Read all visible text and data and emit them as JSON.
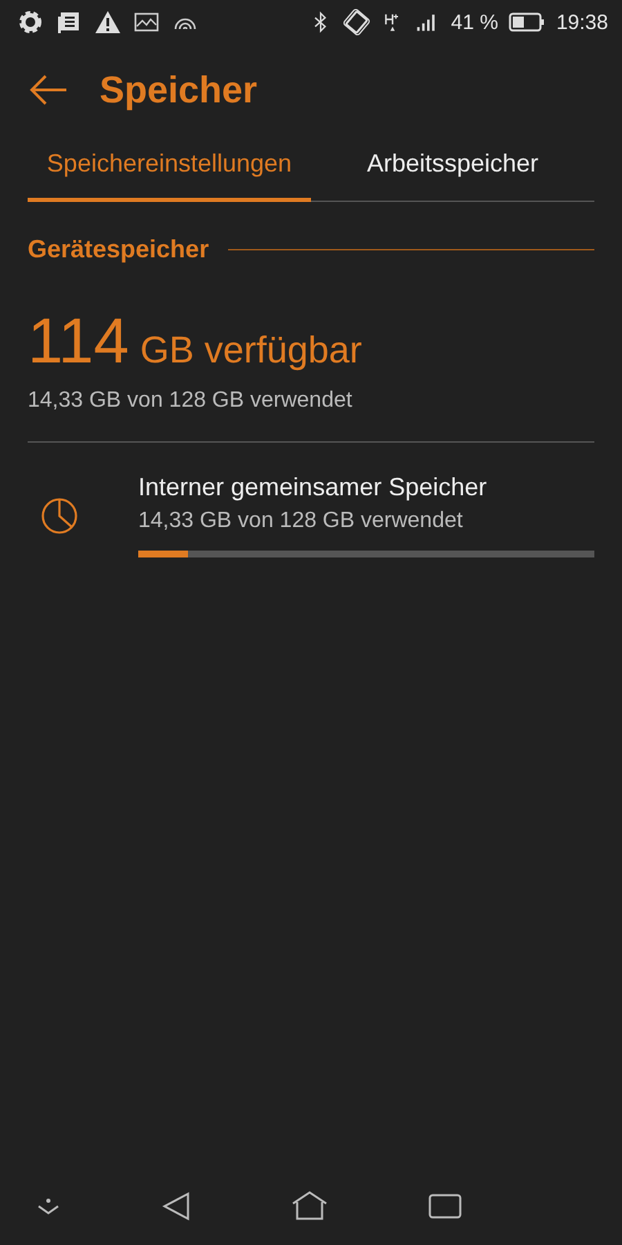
{
  "status_bar": {
    "battery": "41 %",
    "time": "19:38"
  },
  "header": {
    "title": "Speicher"
  },
  "tabs": [
    {
      "label": "Speichereinstellungen",
      "selected": true
    },
    {
      "label": "Arbeitsspeicher",
      "selected": false
    }
  ],
  "section": {
    "title": "Gerätespeicher"
  },
  "summary": {
    "amount": "114",
    "unit": "GB verfügbar",
    "detail": "14,33 GB von 128 GB verwendet"
  },
  "volumes": [
    {
      "name": "Interner gemeinsamer Speicher",
      "detail": "14,33 GB von 128 GB verwendet",
      "level": 0.11
    }
  ]
}
